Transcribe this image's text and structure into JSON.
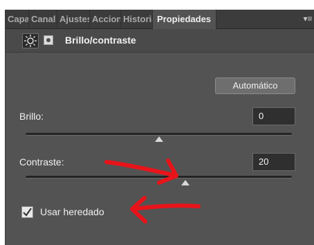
{
  "tabs": [
    {
      "label": "Capas",
      "active": false
    },
    {
      "label": "Canal",
      "active": false
    },
    {
      "label": "Ajustes",
      "active": false
    },
    {
      "label": "Acciones",
      "active": false
    },
    {
      "label": "Historia",
      "active": false
    },
    {
      "label": "Propiedades",
      "active": true
    }
  ],
  "panel_menu_icon": "panel-menu-icon",
  "header": {
    "title": "Brillo/contraste",
    "adjustment_icon": "brightness-sun-icon",
    "mask_icon": "layer-mask-icon"
  },
  "auto_button": {
    "label": "Automático"
  },
  "brightness": {
    "label": "Brillo:",
    "value": "0",
    "slider_fraction": 0.5
  },
  "contrast": {
    "label": "Contraste:",
    "value": "20",
    "slider_fraction": 0.6
  },
  "legacy": {
    "label": "Usar heredado",
    "checked": true
  },
  "annotations": {
    "color": "#e8141a",
    "arrow_icons": [
      "red-arrow-contrast",
      "red-arrow-checkbox"
    ]
  },
  "colors": {
    "panel_bg": "#535353",
    "tabbar_bg": "#3c3c3c",
    "field_bg": "#2f2f2f"
  }
}
